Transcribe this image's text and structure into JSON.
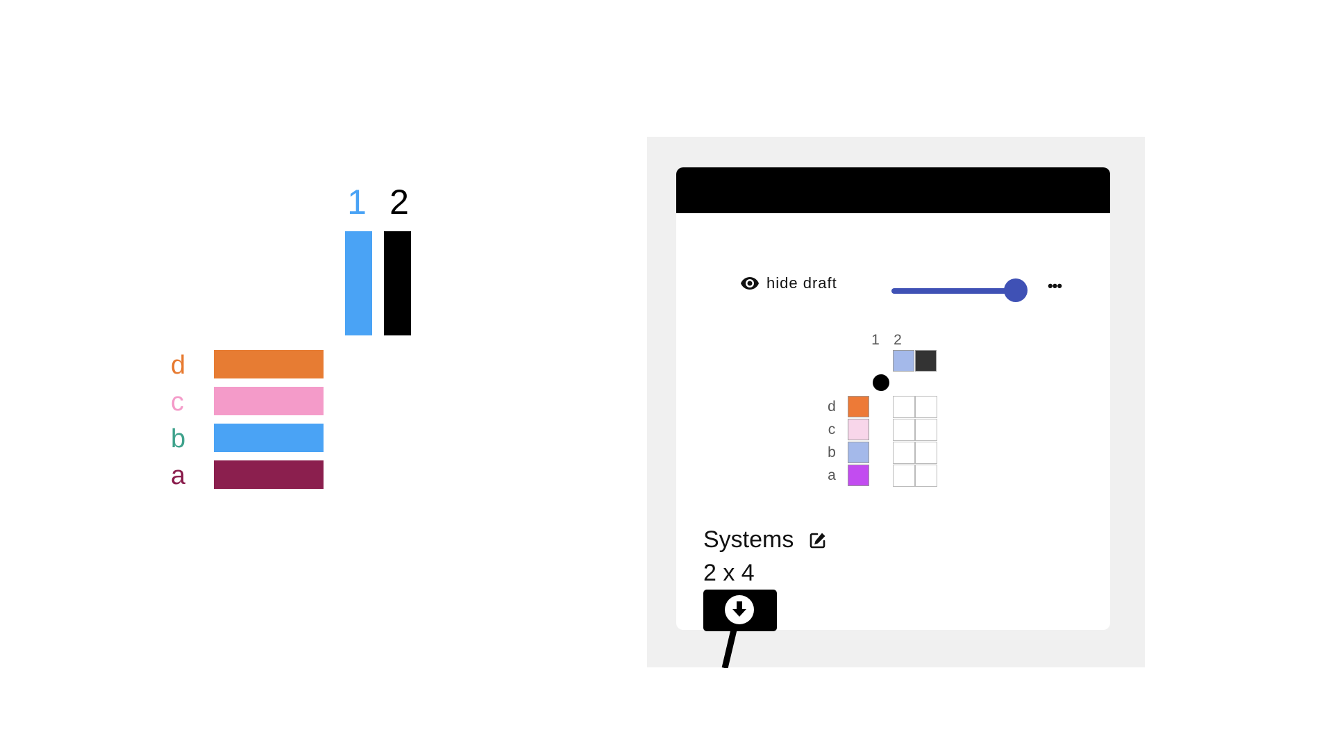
{
  "diagram": {
    "columns": [
      {
        "label": "1",
        "color": "#4aa3f5"
      },
      {
        "label": "2",
        "color": "#000000"
      }
    ],
    "rows": [
      {
        "label": "d",
        "color": "#e77c33"
      },
      {
        "label": "c",
        "color": "#f49bc9"
      },
      {
        "label": "b",
        "color": "#4aa3f5"
      },
      {
        "label": "a",
        "color": "#8b1f4e"
      }
    ],
    "label_colors": {
      "1": "#4aa3f5",
      "2": "#000000",
      "d": "#e77c33",
      "c": "#f49bc9",
      "b": "#3fa28c",
      "a": "#8b1f4e"
    }
  },
  "panel": {
    "toggle_label": "hide draft",
    "toggle_icon": "eye-icon",
    "slider_value": 1.0,
    "more_label": "•••",
    "mini": {
      "columns": [
        {
          "label": "1",
          "color": "#a4b9ea"
        },
        {
          "label": "2",
          "color": "#333333"
        }
      ],
      "rows": [
        {
          "label": "d",
          "color": "#ed7a37"
        },
        {
          "label": "c",
          "color": "#f8d6ea"
        },
        {
          "label": "b",
          "color": "#a4b9ea"
        },
        {
          "label": "a",
          "color": "#c24cf0"
        }
      ]
    },
    "title": "Systems",
    "size_label": "2 x 4",
    "edit_icon": "edit-icon",
    "download_icon": "download-icon"
  }
}
